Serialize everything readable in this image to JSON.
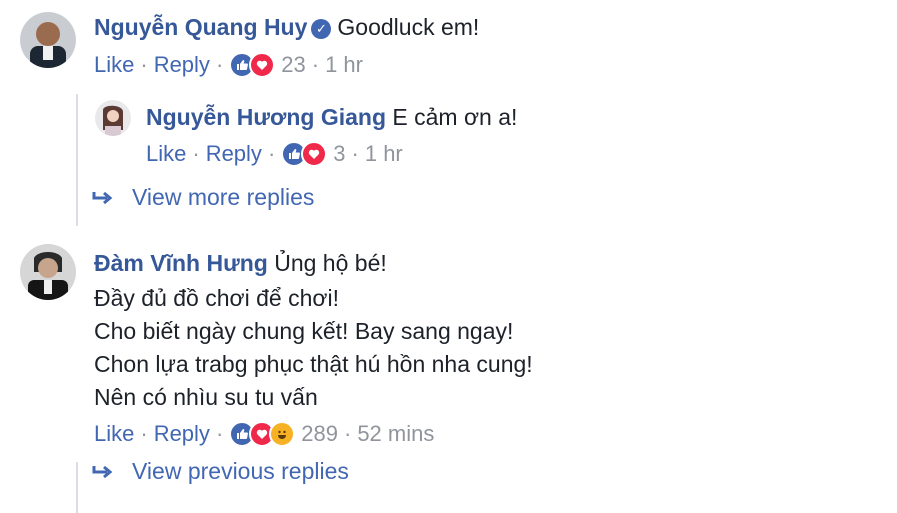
{
  "comments": [
    {
      "author": "Nguyễn Quang Huy",
      "text": "Goodluck em!",
      "like": "Like",
      "reply": "Reply",
      "reactions": "23",
      "time": "1 hr",
      "replies": [
        {
          "author": "Nguyễn Hương Giang",
          "text": "E cảm ơn a!",
          "like": "Like",
          "reply": "Reply",
          "reactions": "3",
          "time": "1 hr"
        }
      ],
      "view_more": "View more replies"
    },
    {
      "author": "Đàm Vĩnh Hưng",
      "lines": [
        "Ủng hộ bé!",
        "Đầy đủ đồ chơi để chơi!",
        "Cho biết ngày chung kết! Bay sang ngay!",
        "Chon lựa trabg phục thật hú hồn nha cung!",
        "Nên có nhìu su tu vấn"
      ],
      "like": "Like",
      "reply": "Reply",
      "reactions": "289",
      "time": "52 mins",
      "view_previous": "View previous replies"
    }
  ],
  "colors": {
    "link": "#365899",
    "meta": "#90949c",
    "like_blue": "#4267b2",
    "love_red": "#f0284a",
    "haha_yellow": "#f7b125"
  }
}
